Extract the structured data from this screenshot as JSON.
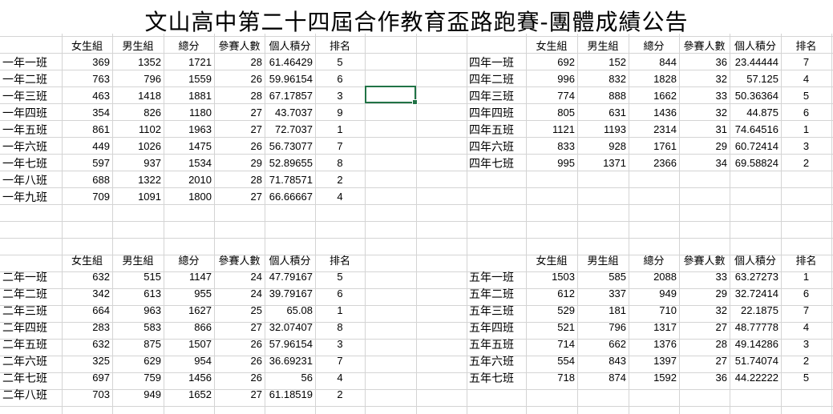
{
  "title": "文山高中第二十四屆合作教育盃路跑賽-團體成績公告",
  "headers": [
    "女生組",
    "男生組",
    "總分",
    "參賽人數",
    "個人積分",
    "排名"
  ],
  "grade1": [
    {
      "name": "一年一班",
      "f": "369",
      "m": "1352",
      "total": "1721",
      "n": "28",
      "score": "61.46429",
      "rank": "5"
    },
    {
      "name": "一年二班",
      "f": "763",
      "m": "796",
      "total": "1559",
      "n": "26",
      "score": "59.96154",
      "rank": "6"
    },
    {
      "name": "一年三班",
      "f": "463",
      "m": "1418",
      "total": "1881",
      "n": "28",
      "score": "67.17857",
      "rank": "3"
    },
    {
      "name": "一年四班",
      "f": "354",
      "m": "826",
      "total": "1180",
      "n": "27",
      "score": "43.7037",
      "rank": "9"
    },
    {
      "name": "一年五班",
      "f": "861",
      "m": "1102",
      "total": "1963",
      "n": "27",
      "score": "72.7037",
      "rank": "1"
    },
    {
      "name": "一年六班",
      "f": "449",
      "m": "1026",
      "total": "1475",
      "n": "26",
      "score": "56.73077",
      "rank": "7"
    },
    {
      "name": "一年七班",
      "f": "597",
      "m": "937",
      "total": "1534",
      "n": "29",
      "score": "52.89655",
      "rank": "8"
    },
    {
      "name": "一年八班",
      "f": "688",
      "m": "1322",
      "total": "2010",
      "n": "28",
      "score": "71.78571",
      "rank": "2"
    },
    {
      "name": "一年九班",
      "f": "709",
      "m": "1091",
      "total": "1800",
      "n": "27",
      "score": "66.66667",
      "rank": "4"
    }
  ],
  "grade4": [
    {
      "name": "四年一班",
      "f": "692",
      "m": "152",
      "total": "844",
      "n": "36",
      "score": "23.44444",
      "rank": "7"
    },
    {
      "name": "四年二班",
      "f": "996",
      "m": "832",
      "total": "1828",
      "n": "32",
      "score": "57.125",
      "rank": "4"
    },
    {
      "name": "四年三班",
      "f": "774",
      "m": "888",
      "total": "1662",
      "n": "33",
      "score": "50.36364",
      "rank": "5"
    },
    {
      "name": "四年四班",
      "f": "805",
      "m": "631",
      "total": "1436",
      "n": "32",
      "score": "44.875",
      "rank": "6"
    },
    {
      "name": "四年五班",
      "f": "1121",
      "m": "1193",
      "total": "2314",
      "n": "31",
      "score": "74.64516",
      "rank": "1"
    },
    {
      "name": "四年六班",
      "f": "833",
      "m": "928",
      "total": "1761",
      "n": "29",
      "score": "60.72414",
      "rank": "3"
    },
    {
      "name": "四年七班",
      "f": "995",
      "m": "1371",
      "total": "2366",
      "n": "34",
      "score": "69.58824",
      "rank": "2"
    }
  ],
  "grade2": [
    {
      "name": "二年一班",
      "f": "632",
      "m": "515",
      "total": "1147",
      "n": "24",
      "score": "47.79167",
      "rank": "5"
    },
    {
      "name": "二年二班",
      "f": "342",
      "m": "613",
      "total": "955",
      "n": "24",
      "score": "39.79167",
      "rank": "6"
    },
    {
      "name": "二年三班",
      "f": "664",
      "m": "963",
      "total": "1627",
      "n": "25",
      "score": "65.08",
      "rank": "1"
    },
    {
      "name": "二年四班",
      "f": "283",
      "m": "583",
      "total": "866",
      "n": "27",
      "score": "32.07407",
      "rank": "8"
    },
    {
      "name": "二年五班",
      "f": "632",
      "m": "875",
      "total": "1507",
      "n": "26",
      "score": "57.96154",
      "rank": "3"
    },
    {
      "name": "二年六班",
      "f": "325",
      "m": "629",
      "total": "954",
      "n": "26",
      "score": "36.69231",
      "rank": "7"
    },
    {
      "name": "二年七班",
      "f": "697",
      "m": "759",
      "total": "1456",
      "n": "26",
      "score": "56",
      "rank": "4"
    },
    {
      "name": "二年八班",
      "f": "703",
      "m": "949",
      "total": "1652",
      "n": "27",
      "score": "61.18519",
      "rank": "2"
    }
  ],
  "grade5": [
    {
      "name": "五年一班",
      "f": "1503",
      "m": "585",
      "total": "2088",
      "n": "33",
      "score": "63.27273",
      "rank": "1"
    },
    {
      "name": "五年二班",
      "f": "612",
      "m": "337",
      "total": "949",
      "n": "29",
      "score": "32.72414",
      "rank": "6"
    },
    {
      "name": "五年三班",
      "f": "529",
      "m": "181",
      "total": "710",
      "n": "32",
      "score": "22.1875",
      "rank": "7"
    },
    {
      "name": "五年四班",
      "f": "521",
      "m": "796",
      "total": "1317",
      "n": "27",
      "score": "48.77778",
      "rank": "4"
    },
    {
      "name": "五年五班",
      "f": "714",
      "m": "662",
      "total": "1376",
      "n": "28",
      "score": "49.14286",
      "rank": "3"
    },
    {
      "name": "五年六班",
      "f": "554",
      "m": "843",
      "total": "1397",
      "n": "27",
      "score": "51.74074",
      "rank": "2"
    },
    {
      "name": "五年七班",
      "f": "718",
      "m": "874",
      "total": "1592",
      "n": "36",
      "score": "44.22222",
      "rank": "5"
    }
  ]
}
